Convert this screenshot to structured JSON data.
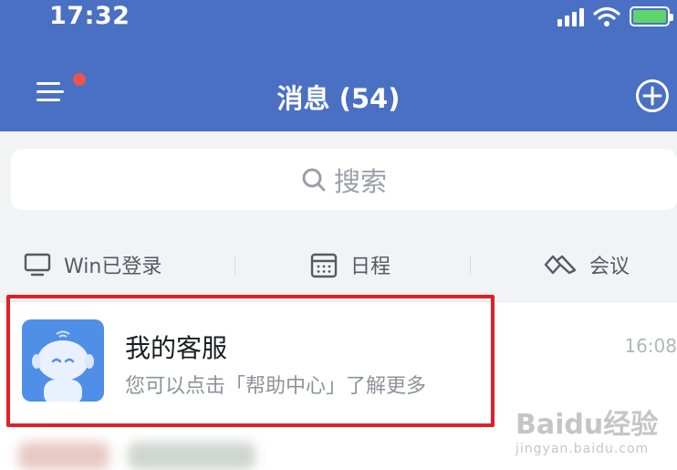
{
  "status_bar": {
    "time": "17:32"
  },
  "header": {
    "title": "消息 (54)"
  },
  "search": {
    "placeholder": "搜索"
  },
  "quick_tabs": [
    {
      "label": "Win已登录",
      "icon": "monitor-icon"
    },
    {
      "label": "日程",
      "icon": "calendar-icon"
    },
    {
      "label": "会议",
      "icon": "meeting-icon"
    }
  ],
  "conversation": {
    "name": "我的客服",
    "preview": "您可以点击「帮助中心」了解更多",
    "time": "16:08"
  },
  "watermark": {
    "brand": "Baidu经验",
    "url": "jingyan.baidu.com"
  },
  "colors": {
    "header": "#4a70c4",
    "highlight": "#e02028",
    "badge": "#ef5350"
  }
}
